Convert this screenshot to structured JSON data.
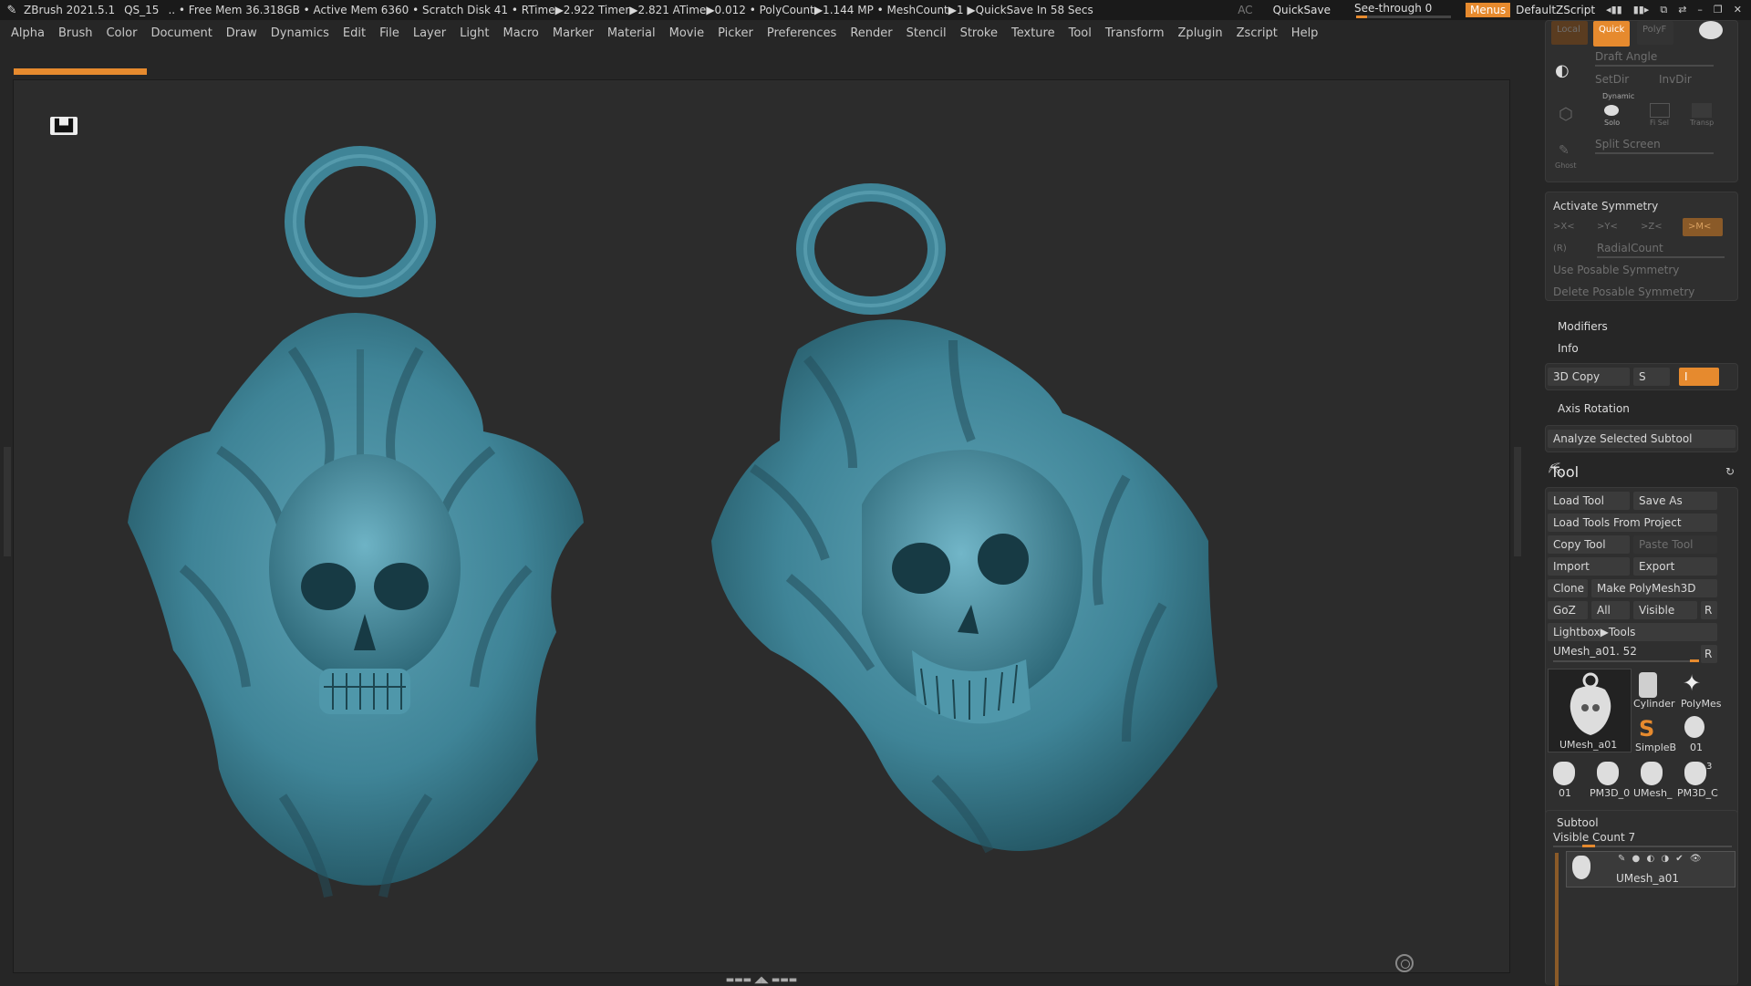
{
  "titlebar": {
    "app": "ZBrush 2021.5.1",
    "project": "QS_15",
    "stats": ".. • Free Mem 36.318GB • Active Mem 6360 • Scratch Disk 41 •  RTime▶2.922 Timer▶2.821 ATime▶0.012 • PolyCount▶1.144 MP  • MeshCount▶1  ▶QuickSave In 58 Secs",
    "ac": "AC",
    "quicksave": "QuickSave",
    "seethrough": "See-through  0",
    "menus": "Menus",
    "script": "DefaultZScript"
  },
  "menu": [
    "Alpha",
    "Brush",
    "Color",
    "Document",
    "Draw",
    "Dynamics",
    "Edit",
    "File",
    "Layer",
    "Light",
    "Macro",
    "Marker",
    "Material",
    "Movie",
    "Picker",
    "Preferences",
    "Render",
    "Stencil",
    "Stroke",
    "Texture",
    "Tool",
    "Transform",
    "Zplugin",
    "Zscript",
    "Help"
  ],
  "panel": {
    "top_buttons": {
      "local": "Local",
      "quick": "Quick",
      "polyf": "PolyF"
    },
    "draft_angle": "Draft Angle",
    "setdir": "SetDir",
    "invdir": "InvDir",
    "dynamic": "Dynamic",
    "solo": "Solo",
    "fisel": "Fi Sel",
    "transp": "Transp",
    "split_screen": "Split Screen",
    "ghost": "Ghost",
    "activate_symmetry": "Activate Symmetry",
    "sym_x": ">X<",
    "sym_y": ">Y<",
    "sym_z": ">Z<",
    "sym_m": ">M<",
    "sym_r": "(R)",
    "radial_count": "RadialCount",
    "use_posable": "Use Posable Symmetry",
    "delete_posable": "Delete Posable Symmetry",
    "modifiers": "Modifiers",
    "info": "Info",
    "copy3d": "3D Copy",
    "copy3d_s": "S",
    "copy3d_val": "I",
    "axis_rotation": "Axis Rotation",
    "analyze": "Analyze Selected Subtool",
    "tool": "Tool",
    "load_tool": "Load Tool",
    "save_as": "Save As",
    "load_from_project": "Load Tools From Project",
    "copy_tool": "Copy Tool",
    "paste_tool": "Paste Tool",
    "import": "Import",
    "export": "Export",
    "clone": "Clone",
    "make_polymesh": "Make PolyMesh3D",
    "goz": "GoZ",
    "all": "All",
    "visible": "Visible",
    "r": "R",
    "lightbox_tools": "Lightbox▶Tools",
    "current_tool": "UMesh_a01. 52",
    "r2": "R",
    "thumbs": [
      "UMesh_a01",
      "Cylinder",
      "PolyMes",
      "SimpleB",
      "01",
      "01",
      "PM3D_0",
      "UMesh_",
      "PM3D_C"
    ],
    "thumb_num": "3",
    "subtool": "Subtool",
    "visible_count": "Visible Count 7",
    "subtool_name": "UMesh_a01"
  }
}
